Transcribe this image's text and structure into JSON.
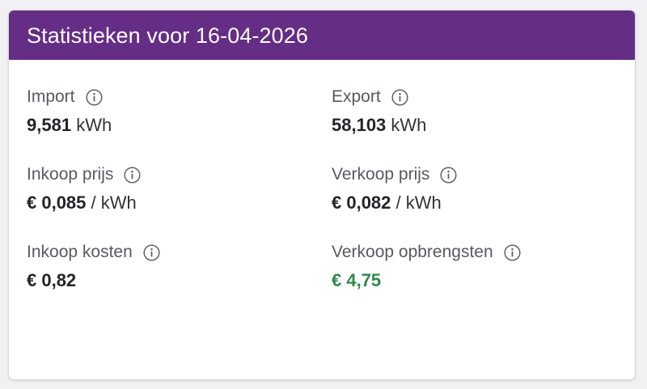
{
  "header": {
    "title": "Statistieken voor 16-04-2026",
    "background_color": "#652d86"
  },
  "stats": {
    "import": {
      "label": "Import",
      "value": "9,581",
      "unit": "kWh"
    },
    "export": {
      "label": "Export",
      "value": "58,103",
      "unit": "kWh"
    },
    "inkoop_prijs": {
      "label": "Inkoop prijs",
      "value": "€ 0,085",
      "unit": "/ kWh"
    },
    "verkoop_prijs": {
      "label": "Verkoop prijs",
      "value": "€ 0,082",
      "unit": "/ kWh"
    },
    "inkoop_kosten": {
      "label": "Inkoop kosten",
      "value": "€ 0,82",
      "unit": ""
    },
    "verkoop_opbrengsten": {
      "label": "Verkoop opbrengsten",
      "value": "€ 4,75",
      "unit": "",
      "value_color": "#2f8a4c"
    }
  },
  "icons": {
    "info": "info-circle-icon"
  }
}
